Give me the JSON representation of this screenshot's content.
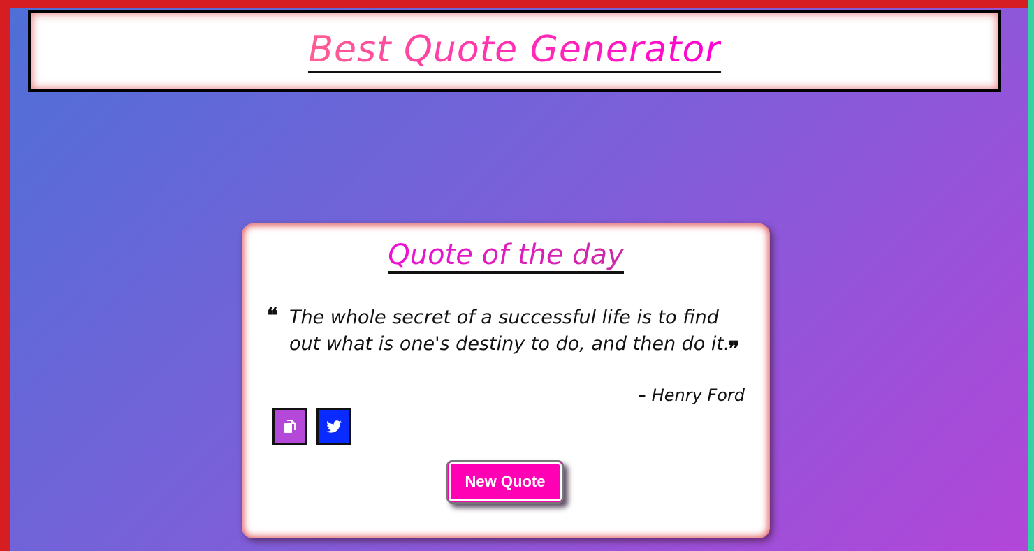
{
  "header": {
    "title": "Best Quote Generator"
  },
  "card": {
    "title": "Quote of the day",
    "quote": "The whole secret of a successful life is to find out what is one's destiny to do, and then do it.",
    "dash": "–",
    "author": "Henry Ford",
    "open_quote_glyph": "❝",
    "close_quote_glyph": "❞",
    "copy_button_icon": "copy-icon",
    "tweet_button_icon": "twitter-icon",
    "new_quote_label": "New Quote"
  },
  "colors": {
    "page_frame": "#d51d22",
    "title_gradient_start": "#ff5e92",
    "title_gradient_end": "#ff00d4",
    "copy_button": "#b448d8",
    "tweet_button": "#0a2bff",
    "new_quote_button": "#ff00b4"
  }
}
